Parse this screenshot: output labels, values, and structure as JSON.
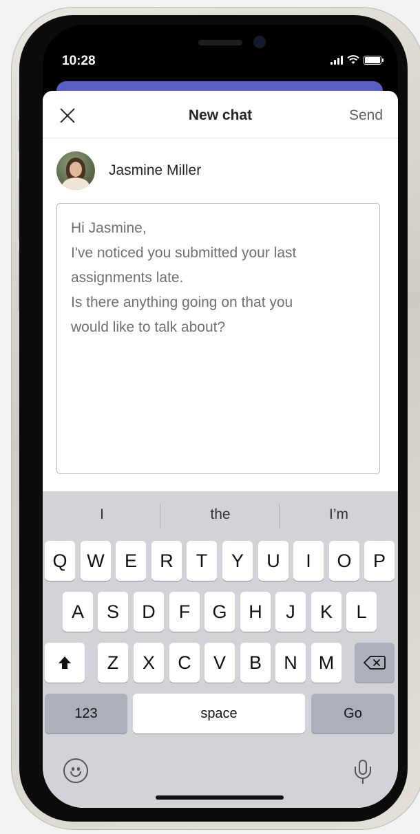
{
  "status_bar": {
    "time": "10:28"
  },
  "header": {
    "title": "New chat",
    "send_label": "Send"
  },
  "recipient": {
    "name": "Jasmine Miller"
  },
  "message": {
    "lines": [
      "Hi Jasmine,",
      "I've noticed you submitted your last",
      "assignments late.",
      "Is there anything going on that you",
      "would like to talk about?"
    ]
  },
  "keyboard": {
    "suggestions": [
      "I",
      "the",
      "I’m"
    ],
    "row1": [
      "Q",
      "W",
      "E",
      "R",
      "T",
      "Y",
      "U",
      "I",
      "O",
      "P"
    ],
    "row2": [
      "A",
      "S",
      "D",
      "F",
      "G",
      "H",
      "J",
      "K",
      "L"
    ],
    "row3": [
      "Z",
      "X",
      "C",
      "V",
      "B",
      "N",
      "M"
    ],
    "numbers_label": "123",
    "space_label": "space",
    "go_label": "Go"
  },
  "colors": {
    "accent": "#5b5fc7",
    "keyboard_bg": "#d1d3d9",
    "key_dark": "#abb0bb"
  }
}
